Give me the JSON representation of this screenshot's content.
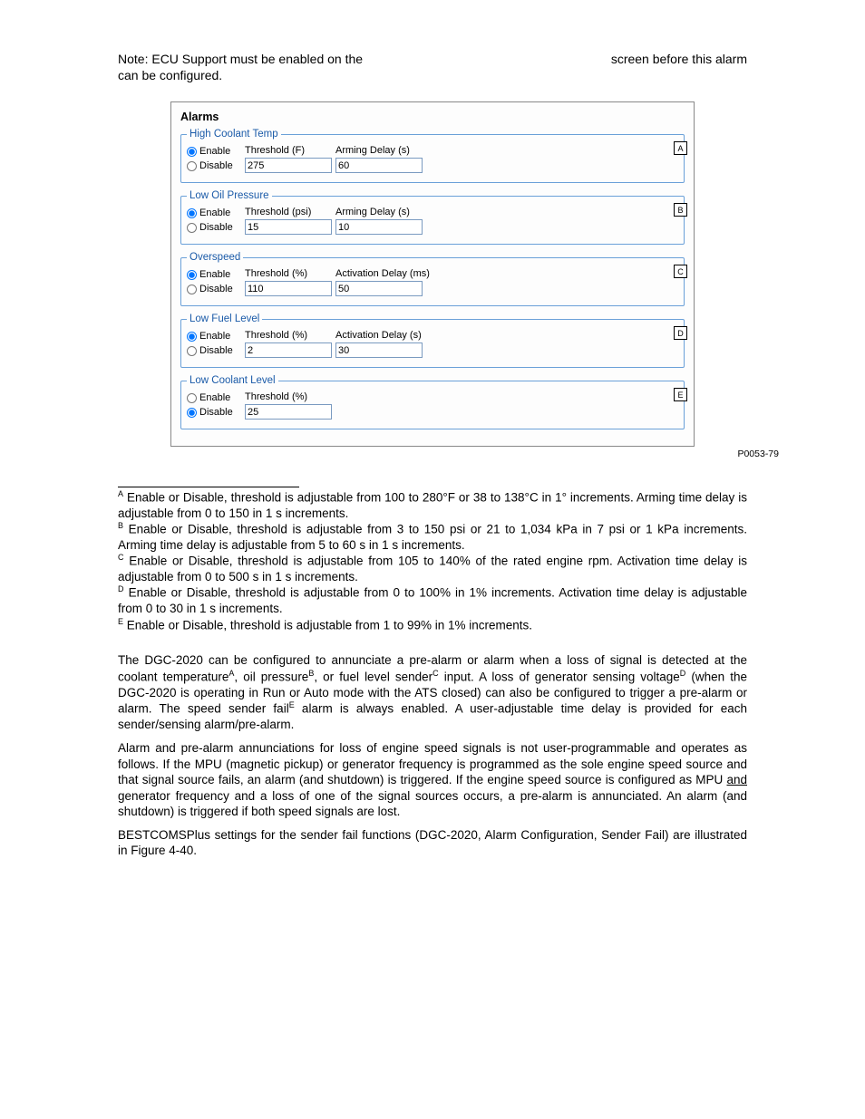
{
  "note": {
    "line1": "Note: ECU Support must be enabled on the",
    "line2": "screen before this alarm can be configured."
  },
  "panel": {
    "title": "Alarms",
    "groups": [
      {
        "legend": "High Coolant Temp",
        "enable_label": "Enable",
        "disable_label": "Disable",
        "enabled": true,
        "field1_label": "Threshold (F)",
        "field1_value": "275",
        "field2_label": "Arming Delay (s)",
        "field2_value": "60",
        "callout": "A"
      },
      {
        "legend": "Low Oil Pressure",
        "enable_label": "Enable",
        "disable_label": "Disable",
        "enabled": true,
        "field1_label": "Threshold (psi)",
        "field1_value": "15",
        "field2_label": "Arming Delay (s)",
        "field2_value": "10",
        "callout": "B"
      },
      {
        "legend": "Overspeed",
        "enable_label": "Enable",
        "disable_label": "Disable",
        "enabled": true,
        "field1_label": "Threshold (%)",
        "field1_value": "110",
        "field2_label": "Activation Delay (ms)",
        "field2_value": "50",
        "callout": "C"
      },
      {
        "legend": "Low Fuel Level",
        "enable_label": "Enable",
        "disable_label": "Disable",
        "enabled": true,
        "field1_label": "Threshold (%)",
        "field1_value": "2",
        "field2_label": "Activation Delay (s)",
        "field2_value": "30",
        "callout": "D"
      },
      {
        "legend": "Low Coolant Level",
        "enable_label": "Enable",
        "disable_label": "Disable",
        "enabled": false,
        "field1_label": "Threshold (%)",
        "field1_value": "25",
        "field2_label": "",
        "field2_value": "",
        "callout": "E",
        "single": true
      }
    ],
    "fig_code": "P0053-79"
  },
  "footnotes": {
    "A": "Enable or Disable, threshold is adjustable from 100 to 280°F or 38 to 138°C in 1° increments. Arming time delay is adjustable from 0 to 150 in 1 s increments.",
    "B": "Enable or Disable, threshold is adjustable from 3 to 150 psi or 21 to 1,034 kPa in 7 psi or 1 kPa increments. Arming time delay is adjustable from 5 to 60 s in 1 s increments.",
    "C": "Enable or Disable, threshold is adjustable from 105 to 140% of the rated engine rpm. Activation time delay is adjustable from 0 to 500 s in 1 s increments.",
    "D": "Enable or Disable, threshold is adjustable from 0 to 100% in 1% increments. Activation time delay is adjustable from 0 to 30 in 1 s increments.",
    "E": "Enable or Disable, threshold is adjustable from 1 to 99% in 1% increments."
  },
  "bodyA_pre": "The DGC-2020 can be configured to annunciate a pre-alarm or alarm when a loss of signal is detected at the coolant temperature",
  "bodyA_mid1": ", oil pressure",
  "bodyA_mid2": ", or fuel level sender",
  "bodyA_mid3": " input. A loss of generator sensing voltage",
  "bodyA_post": " (when the DGC-2020 is operating in Run or Auto mode with the ATS closed) can also be configured to trigger a pre-alarm or alarm. The speed sender fail",
  "bodyA_tail": " alarm is always enabled. A user-adjustable time delay is provided for each sender/sensing alarm/pre-alarm.",
  "bodyB_pre": "Alarm and pre-alarm annunciations for loss of engine speed signals is not user-programmable and operates as follows. If the MPU (magnetic pickup) or generator frequency is programmed as the sole engine speed source and that signal source fails, an alarm (and shutdown) is triggered. If the engine speed source is configured as MPU ",
  "bodyB_and": "and",
  "bodyB_post": " generator frequency and a loss of one of the signal sources occurs, a pre-alarm is annunciated. An alarm (and shutdown) is triggered if both speed signals are lost.",
  "bodyC": "BESTCOMSPlus settings for the sender fail functions (DGC-2020, Alarm Configuration, Sender Fail) are illustrated in Figure 4-40."
}
